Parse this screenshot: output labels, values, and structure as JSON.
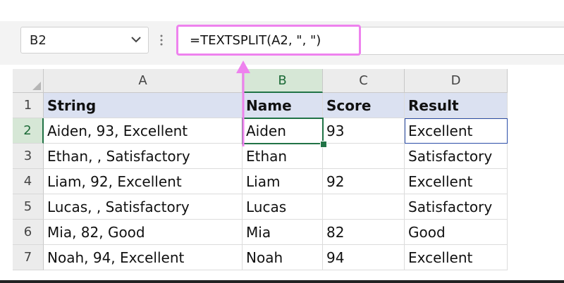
{
  "formula_bar": {
    "name_box": "B2",
    "formula": "=TEXTSPLIT(A2, \", \")"
  },
  "columns": [
    "A",
    "B",
    "C",
    "D"
  ],
  "rows": [
    {
      "num": "1",
      "cells": [
        "String",
        "Name",
        "Score",
        "Result"
      ]
    },
    {
      "num": "2",
      "cells": [
        "Aiden, 93, Excellent",
        "Aiden",
        "93",
        "Excellent"
      ]
    },
    {
      "num": "3",
      "cells": [
        "Ethan, , Satisfactory",
        "Ethan",
        "",
        "Satisfactory"
      ]
    },
    {
      "num": "4",
      "cells": [
        "Liam, 92, Excellent",
        "Liam",
        "92",
        "Excellent"
      ]
    },
    {
      "num": "5",
      "cells": [
        "Lucas, , Satisfactory",
        "Lucas",
        "",
        "Satisfactory"
      ]
    },
    {
      "num": "6",
      "cells": [
        "Mia, 82, Good",
        "Mia",
        "82",
        "Good"
      ]
    },
    {
      "num": "7",
      "cells": [
        "Noah, 94, Excellent",
        "Noah",
        "94",
        "Excellent"
      ]
    }
  ],
  "colors": {
    "formula_highlight": "#ee82ee",
    "arrow": "#ee82ee",
    "selection": "#217346",
    "header_fill": "#dbe1f1"
  },
  "icons": {
    "name_box_dropdown": "chevron-down-icon",
    "formula_bar_menu": "vertical-dots-icon",
    "annotation_arrow": "arrow-up-icon",
    "select_all": "select-all-triangle-icon"
  }
}
